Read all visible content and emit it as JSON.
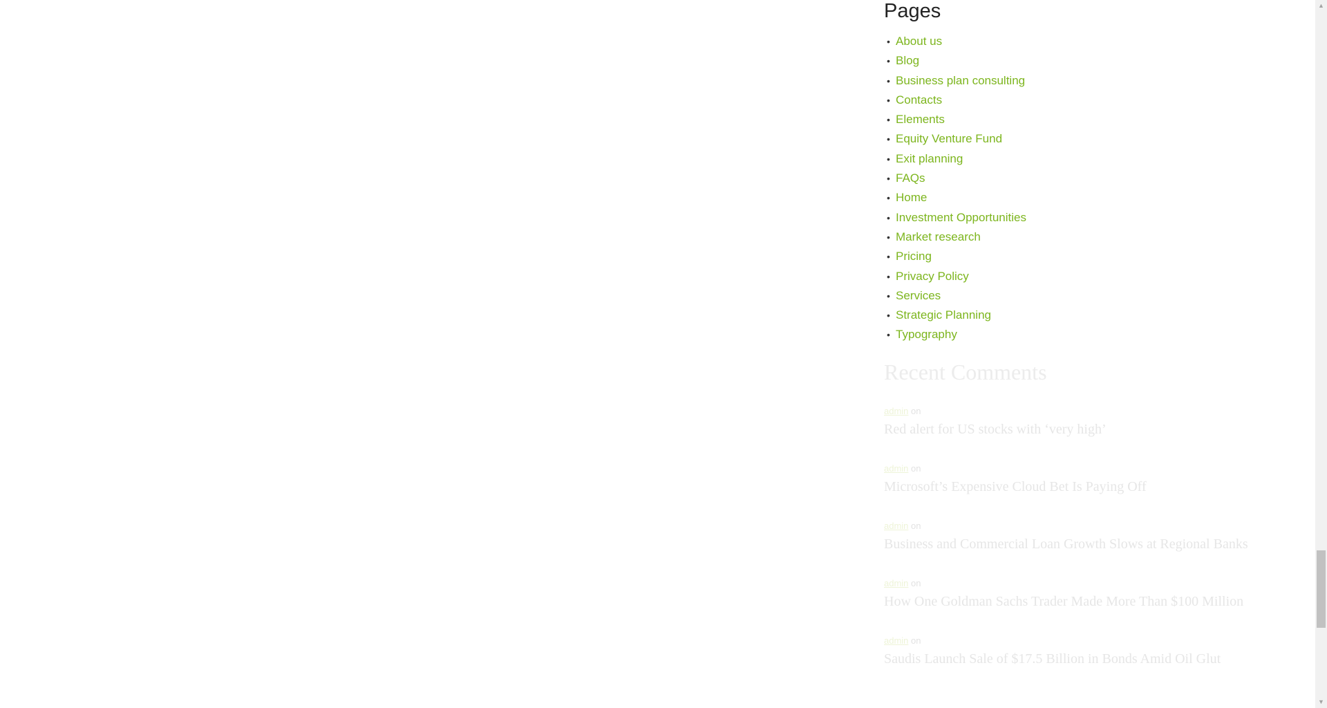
{
  "pages_widget": {
    "title": "Pages",
    "items": [
      {
        "label": "About us"
      },
      {
        "label": "Blog"
      },
      {
        "label": "Business plan consulting"
      },
      {
        "label": "Contacts"
      },
      {
        "label": "Elements"
      },
      {
        "label": "Equity Venture Fund"
      },
      {
        "label": "Exit planning"
      },
      {
        "label": "FAQs"
      },
      {
        "label": "Home"
      },
      {
        "label": "Investment Opportunities"
      },
      {
        "label": "Market research"
      },
      {
        "label": "Pricing"
      },
      {
        "label": "Privacy Policy"
      },
      {
        "label": "Services"
      },
      {
        "label": "Strategic Planning"
      },
      {
        "label": "Typography"
      }
    ]
  },
  "recent_comments": {
    "title": "Recent Comments",
    "items": [
      {
        "author": "admin",
        "on": "on",
        "post": "Red alert for US stocks with ‘very high’"
      },
      {
        "author": "admin",
        "on": "on",
        "post": "Microsoft’s Expensive Cloud Bet Is Paying Off"
      },
      {
        "author": "admin",
        "on": "on",
        "post": "Business and Commercial Loan Growth Slows at Regional Banks"
      },
      {
        "author": "admin",
        "on": "on",
        "post": "How One Goldman Sachs Trader Made More Than $100 Million"
      },
      {
        "author": "admin",
        "on": "on",
        "post": "Saudis Launch Sale of $17.5 Billion in Bonds Amid Oil Glut"
      }
    ]
  },
  "colors": {
    "link": "#7cb51d",
    "heading": "#222222"
  },
  "scrollbar": {
    "up_icon": "▲",
    "down_icon": "▼"
  }
}
